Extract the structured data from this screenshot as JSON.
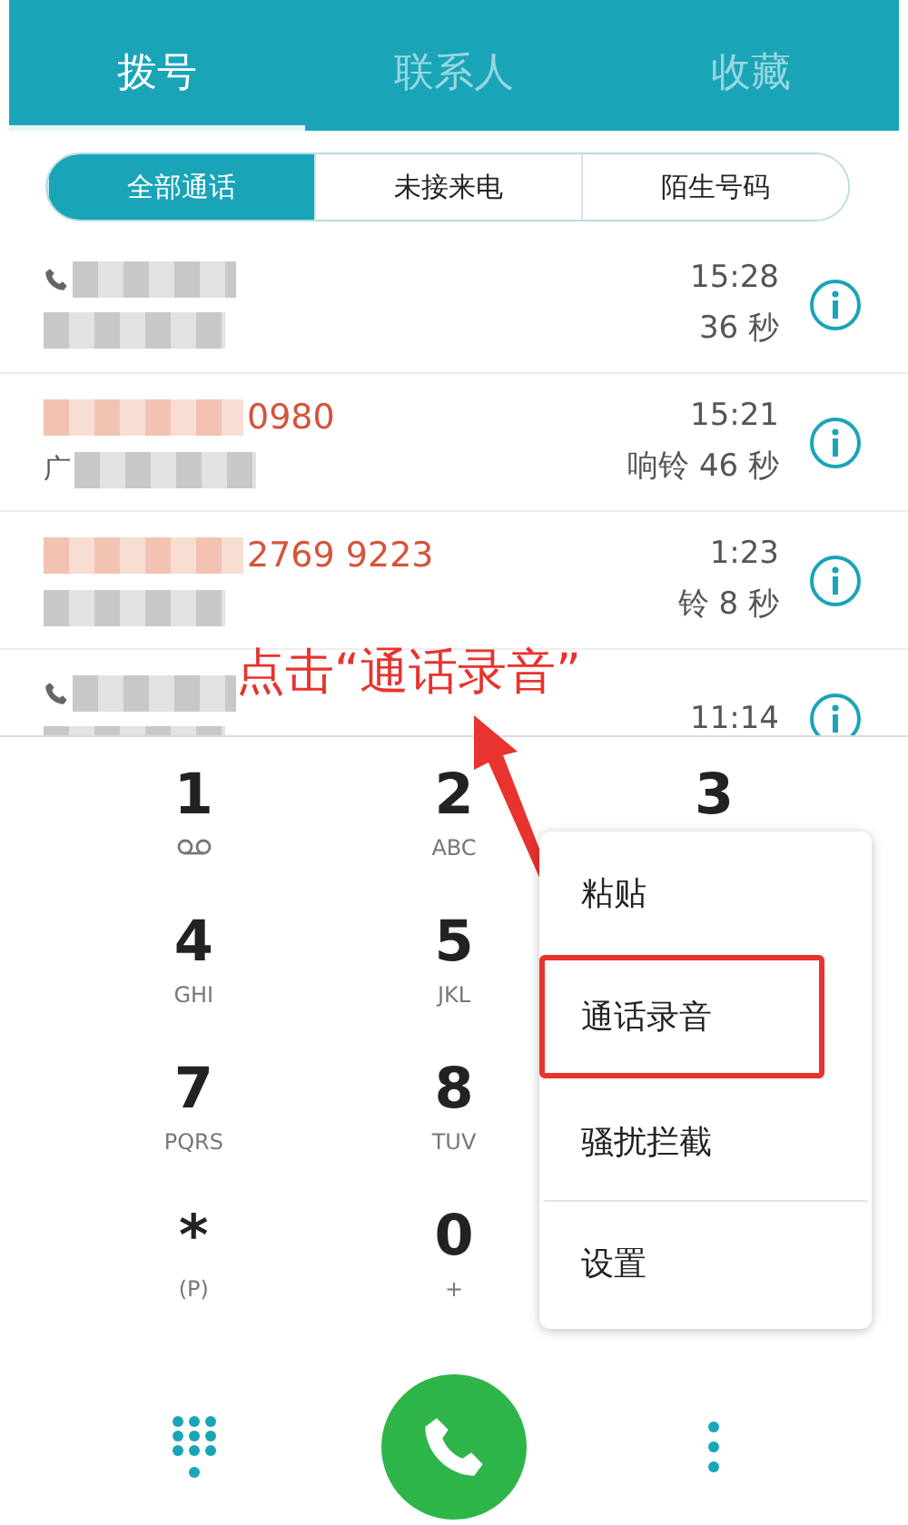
{
  "tabs": [
    {
      "label": "拨号",
      "selected": true
    },
    {
      "label": "联系人",
      "selected": false
    },
    {
      "label": "收藏",
      "selected": false
    }
  ],
  "filters": [
    {
      "label": "全部通话",
      "selected": true
    },
    {
      "label": "未接来电",
      "selected": false
    },
    {
      "label": "陌生号码",
      "selected": false
    }
  ],
  "calls": [
    {
      "missed": false,
      "time": "15:28",
      "duration": "36 秒"
    },
    {
      "missed": true,
      "number": "0980",
      "location": "广",
      "time": "15:21",
      "duration": "响铃 46 秒"
    },
    {
      "missed": true,
      "number": "2769 9223",
      "time": "1:23",
      "duration": "铃 8 秒"
    },
    {
      "missed": false,
      "time": "11:14"
    }
  ],
  "keypad": [
    [
      {
        "digit": "1",
        "kind": "voicemail"
      },
      {
        "digit": "2",
        "letters": "ABC",
        "kind": "letters"
      },
      {
        "digit": "3",
        "kind": "plain"
      }
    ],
    [
      {
        "digit": "4",
        "letters": "GHI",
        "kind": "letters"
      },
      {
        "digit": "5",
        "letters": "JKL",
        "kind": "letters"
      }
    ],
    [
      {
        "digit": "7",
        "letters": "PQRS",
        "kind": "letters"
      },
      {
        "digit": "8",
        "letters": "TUV",
        "kind": "letters"
      }
    ],
    [
      {
        "digit": "*",
        "letters": "(P)",
        "kind": "letters"
      },
      {
        "digit": "0",
        "letters": "+",
        "kind": "letters"
      }
    ]
  ],
  "menu": [
    {
      "label": "粘贴",
      "highlighted": false
    },
    {
      "label": "通话录音",
      "highlighted": true
    },
    {
      "label": "骚扰拦截",
      "highlighted": false
    },
    {
      "label": "设置",
      "highlighted": false
    }
  ],
  "annotation": "点击“通话录音”"
}
